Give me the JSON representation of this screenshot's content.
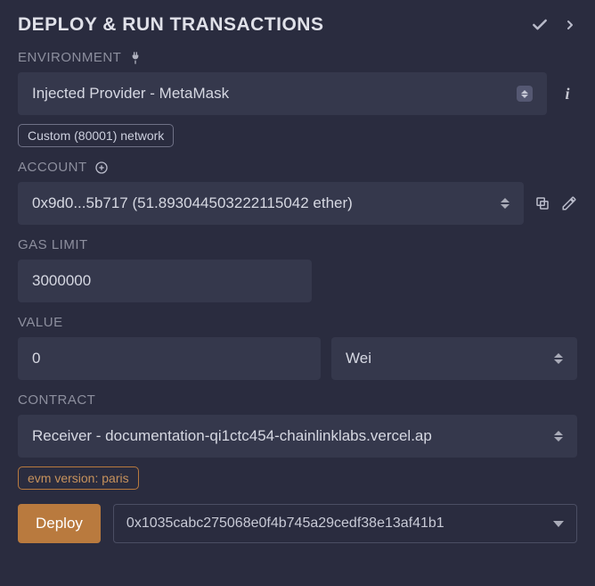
{
  "header": {
    "title": "DEPLOY & RUN TRANSACTIONS"
  },
  "environment": {
    "label": "ENVIRONMENT",
    "selected": "Injected Provider - MetaMask",
    "network_badge": "Custom (80001) network"
  },
  "account": {
    "label": "ACCOUNT",
    "selected": "0x9d0...5b717 (51.893044503222115042 ether)"
  },
  "gas_limit": {
    "label": "GAS LIMIT",
    "value": "3000000"
  },
  "value": {
    "label": "VALUE",
    "amount": "0",
    "unit": "Wei"
  },
  "contract": {
    "label": "CONTRACT",
    "selected": "Receiver - documentation-qi1ctc454-chainlinklabs.vercel.ap",
    "evm_badge": "evm version: paris"
  },
  "deploy": {
    "button": "Deploy",
    "address": "0x1035cabc275068e0f4b745a29cedf38e13af41b1"
  }
}
